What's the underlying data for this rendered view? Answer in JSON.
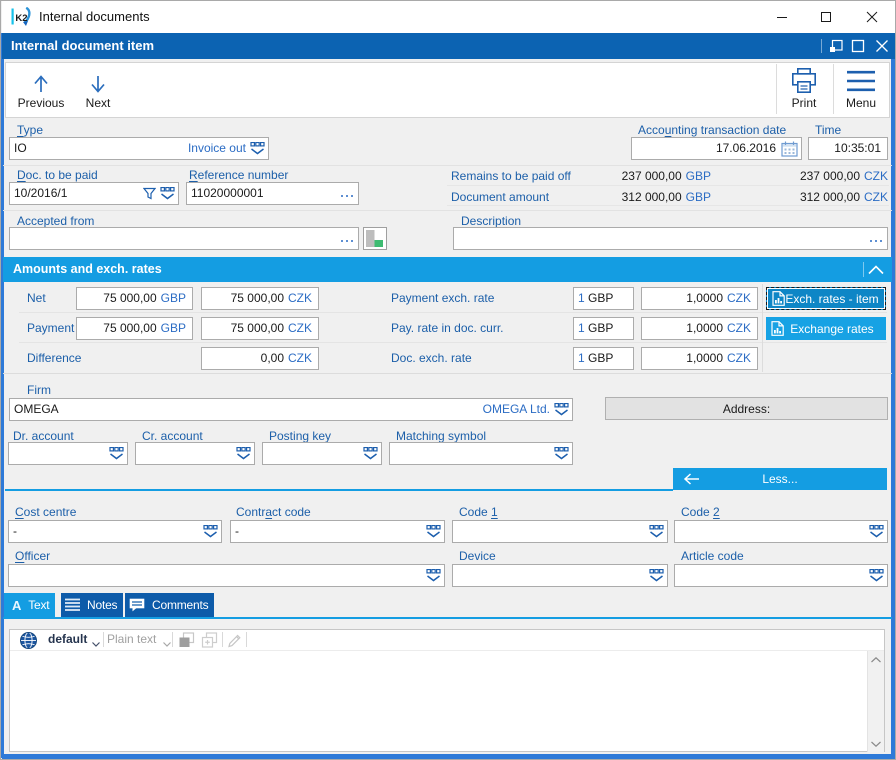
{
  "window": {
    "title": "Internal documents",
    "controls": {
      "minimize": "minimize",
      "maximize": "maximize",
      "close": "close"
    }
  },
  "child_window": {
    "title": "Internal document item",
    "controls": {
      "dock": "dock",
      "maximize": "maximize",
      "close": "close"
    }
  },
  "toolbar": {
    "previous_label": "Previous",
    "next_label": "Next",
    "print_label": "Print",
    "menu_label": "Menu"
  },
  "form": {
    "type": {
      "label": {
        "text": "Type",
        "accel": 0
      },
      "value": "IO",
      "link": "Invoice out"
    },
    "accounting_date": {
      "label": {
        "text": "Accounting transaction date",
        "accel": 4
      },
      "value": "17.06.2016"
    },
    "time": {
      "label": {
        "text": "Time"
      },
      "value": "10:35:01"
    },
    "doc_to_be_paid": {
      "label": {
        "text": "Doc. to be paid",
        "accel": 0
      },
      "value": "10/2016/1"
    },
    "reference_number": {
      "label": {
        "text": "Reference number",
        "accel": 0
      },
      "value": "11020000001"
    },
    "remains": {
      "label": "Remains to be paid off",
      "doc": {
        "amount": "237 000,00",
        "currency": "GBP"
      },
      "local": {
        "amount": "237 000,00",
        "currency": "CZK"
      }
    },
    "document_amount": {
      "label": "Document amount",
      "doc": {
        "amount": "312 000,00",
        "currency": "GBP"
      },
      "local": {
        "amount": "312 000,00",
        "currency": "CZK"
      }
    },
    "accepted_from": {
      "label": {
        "text": "Accepted from"
      },
      "value": ""
    },
    "description": {
      "label": {
        "text": "Description",
        "accel": 1
      },
      "value": ""
    }
  },
  "amounts_section": {
    "title": "Amounts and exch. rates",
    "rows": [
      {
        "label": "Net",
        "doc": {
          "amount": "75 000,00",
          "currency": "GBP"
        },
        "local": {
          "amount": "75 000,00",
          "currency": "CZK"
        }
      },
      {
        "label": "Payment",
        "doc": {
          "amount": "75 000,00",
          "currency": "GBP"
        },
        "local": {
          "amount": "75 000,00",
          "currency": "CZK"
        }
      },
      {
        "label": "Difference",
        "local": {
          "amount": "0,00",
          "currency": "CZK"
        }
      }
    ],
    "rates": [
      {
        "label": "Payment exch. rate",
        "unit_amount": "1",
        "unit_currency": "GBP",
        "rate_amount": "1,0000",
        "rate_currency": "CZK"
      },
      {
        "label": "Pay. rate in doc. curr.",
        "unit_amount": "1",
        "unit_currency": "GBP",
        "rate_amount": "1,0000",
        "rate_currency": "CZK"
      },
      {
        "label": "Doc. exch. rate",
        "unit_amount": "1",
        "unit_currency": "GBP",
        "rate_amount": "1,0000",
        "rate_currency": "CZK"
      }
    ],
    "exch_rates_item_button": "Exch. rates - item",
    "exchange_rates_button": "Exchange rates"
  },
  "firm": {
    "label": {
      "text": "Firm"
    },
    "value": "OMEGA",
    "link": "OMEGA Ltd.",
    "address_button": "Address:"
  },
  "accounts": {
    "dr_account": {
      "label": {
        "text": "Dr. account",
        "accel": 2,
        "len": 2
      },
      "value": ""
    },
    "cr_account": {
      "label": {
        "text": "Cr. account",
        "accel": 2,
        "len": 2
      },
      "value": ""
    },
    "posting_key": {
      "label": {
        "text": "Posting key",
        "accel": 4
      },
      "value": ""
    },
    "matching_symbol": {
      "label": {
        "text": "Matching symbol",
        "accel": 10
      },
      "value": ""
    }
  },
  "less_button": "Less...",
  "codes": {
    "cost_centre": {
      "label": {
        "text": "Cost centre",
        "accel": 0
      },
      "value": "-"
    },
    "contract_code": {
      "label": {
        "text": "Contract code",
        "accel": 5
      },
      "value": "-"
    },
    "code1": {
      "label": {
        "text": "Code 1",
        "accel": 5
      },
      "value": ""
    },
    "code2": {
      "label": {
        "text": "Code 2",
        "accel": 5
      },
      "value": ""
    },
    "officer": {
      "label": {
        "text": "Officer",
        "accel": 0
      },
      "value": ""
    },
    "device": {
      "label": {
        "text": "Device"
      },
      "value": ""
    },
    "article_code": {
      "label": {
        "text": "Article code"
      },
      "value": ""
    }
  },
  "tabs": [
    {
      "label": "Text",
      "active": true
    },
    {
      "label": "Notes",
      "active": false
    },
    {
      "label": "Comments",
      "active": false
    }
  ],
  "editor": {
    "language_button": "default",
    "format_button": "Plain text",
    "content": ""
  },
  "colors": {
    "accent_cyan": "#149de2",
    "titlebar_blue": "#0c63b2",
    "frame_blue": "#2e7ad8",
    "label_blue": "#1c5fa9",
    "currency_blue": "#2b6cc4"
  }
}
